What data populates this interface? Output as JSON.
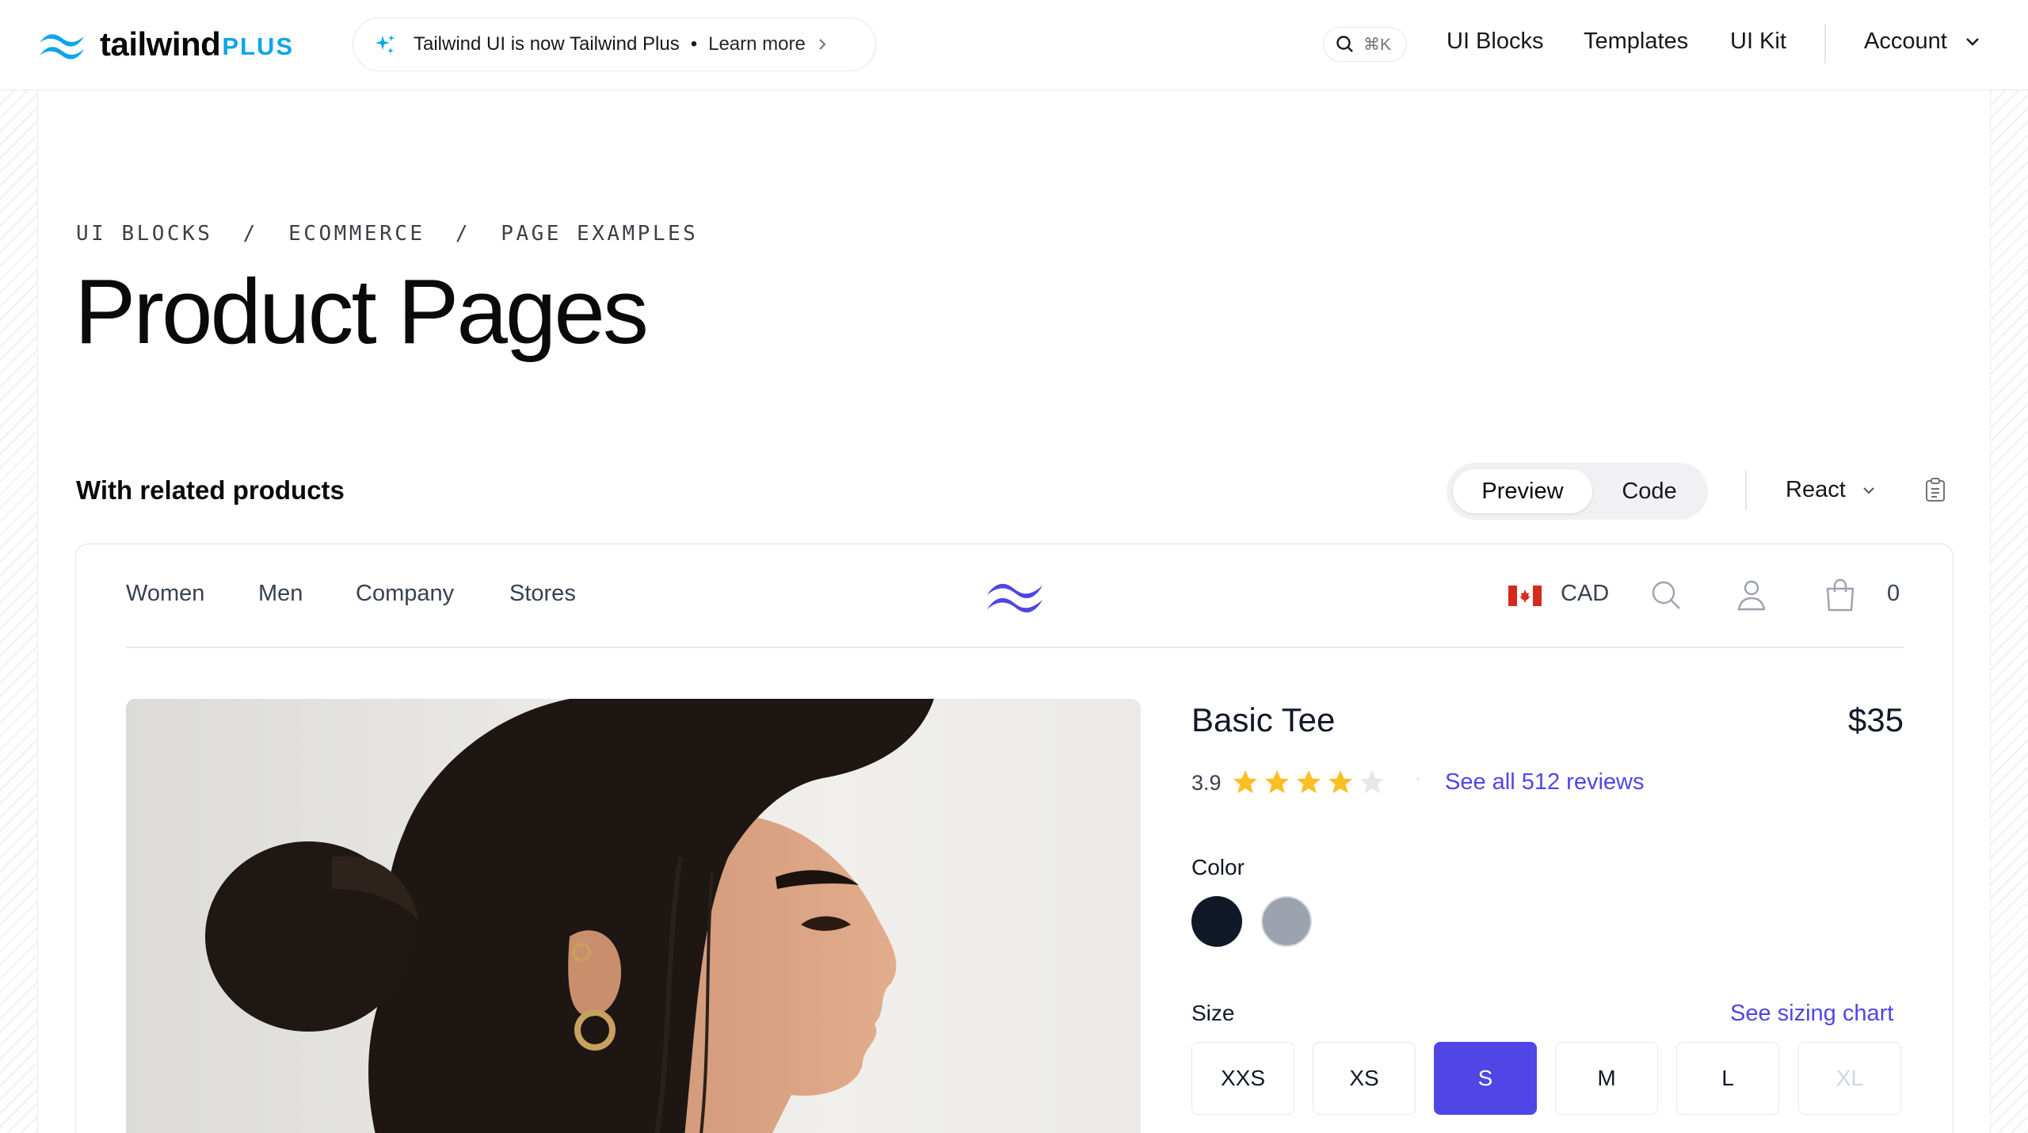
{
  "topnav": {
    "brand": "tailwind",
    "brand_suffix": "PLUS",
    "announcement": "Tailwind UI is now Tailwind Plus",
    "announcement_sep": "•",
    "announcement_link": "Learn more",
    "search_shortcut": "⌘K",
    "links": [
      "UI Blocks",
      "Templates",
      "UI Kit"
    ],
    "account": "Account"
  },
  "header": {
    "breadcrumb": "UI BLOCKS  /  ECOMMERCE  /  PAGE EXAMPLES",
    "title": "Product Pages"
  },
  "example": {
    "title": "With related products",
    "tabs": [
      "Preview",
      "Code"
    ],
    "framework": "React"
  },
  "shop": {
    "nav": [
      "Women",
      "Men",
      "Company",
      "Stores"
    ],
    "currency": "CAD",
    "cart_count": "0",
    "product": {
      "name": "Basic Tee",
      "price": "$35",
      "rating": "3.9",
      "rating_value": 3.9,
      "rating_max": 5,
      "rating_sep": "·",
      "reviews_link": "See all 512 reviews",
      "color_label": "Color",
      "colors": [
        "#111827",
        "#9ca3af"
      ],
      "size_label": "Size",
      "size_chart_link": "See sizing chart",
      "sizes": [
        "XXS",
        "XS",
        "S",
        "M",
        "L",
        "XL"
      ],
      "selected_size": "S",
      "unavailable_size": "XL"
    }
  },
  "colors": {
    "accent": "#4f46e5",
    "brand": "#0ea5e9",
    "star": "#fbbf24"
  }
}
